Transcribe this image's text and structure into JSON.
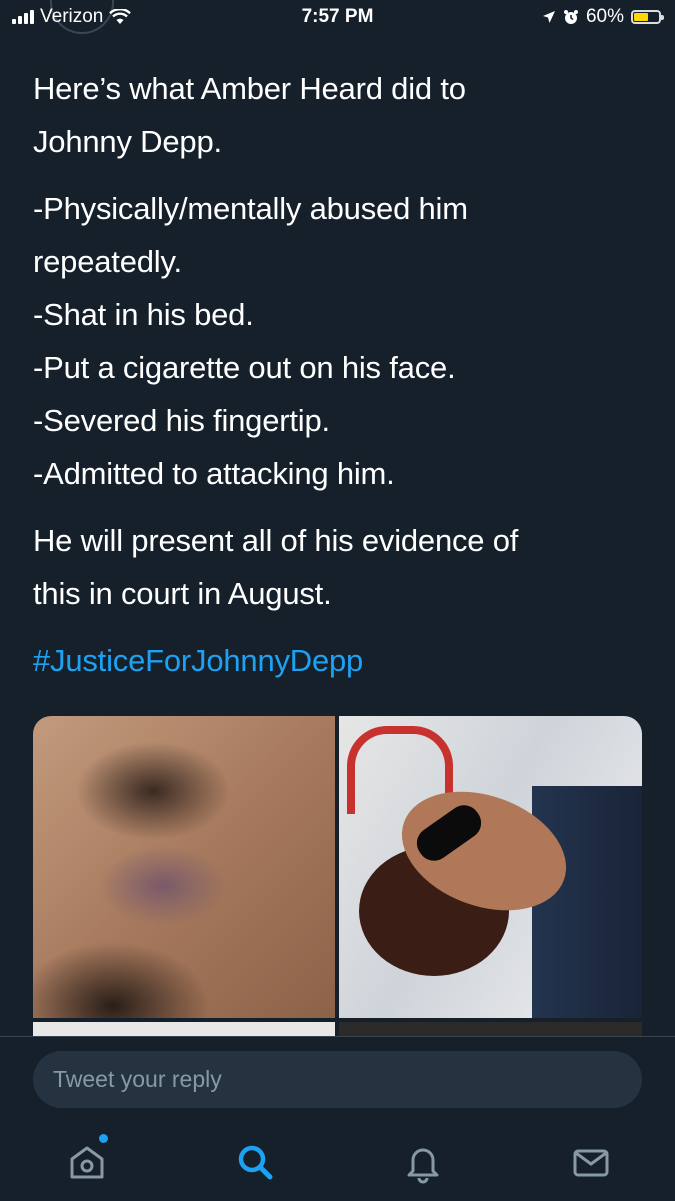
{
  "status_bar": {
    "carrier": "Verizon",
    "time": "7:57 PM",
    "battery": "60%",
    "battery_level": 0.6
  },
  "tweet": {
    "paragraphs": [
      {
        "lines": [
          "Here’s what Amber Heard did to",
          "Johnny Depp."
        ]
      },
      {
        "lines": [
          "-Physically/mentally abused him",
          "repeatedly.",
          "-Shat in his bed.",
          "-Put a cigarette out on his face.",
          "-Severed his fingertip.",
          "-Admitted to attacking him."
        ]
      },
      {
        "lines": [
          "He will present all of his evidence of",
          "this in court in August."
        ]
      }
    ],
    "hashtag": "#JusticeForJohnnyDepp"
  },
  "reply": {
    "placeholder": "Tweet your reply"
  },
  "nav": {
    "items": [
      "home-icon",
      "search-icon",
      "bell-icon",
      "mail-icon"
    ],
    "accent": "#1da1f2"
  },
  "colors": {
    "background": "#15202b",
    "accent": "#1da1f2",
    "muted": "#8899a6"
  }
}
